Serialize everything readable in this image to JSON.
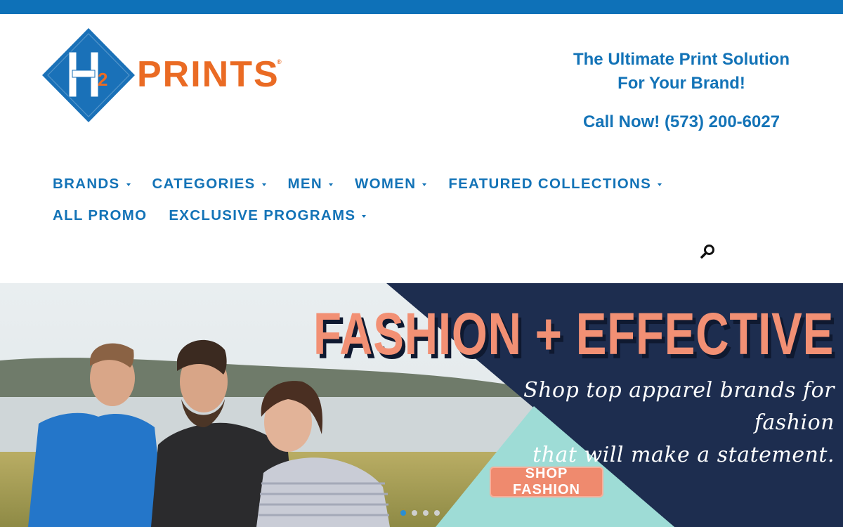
{
  "brand": {
    "logo_mark": "H2",
    "logo_text": "PRINTS",
    "logo_registered": "®",
    "colors": {
      "blue": "#1373b7",
      "orange": "#ea6b24",
      "top_bar": "#0e71b8"
    }
  },
  "header": {
    "tagline_line1": "The Ultimate Print Solution",
    "tagline_line2": "For Your Brand!",
    "phone": "Call Now! (573) 200-6027"
  },
  "nav": {
    "row1": [
      {
        "label": "BRANDS",
        "dropdown": true
      },
      {
        "label": "CATEGORIES",
        "dropdown": true
      },
      {
        "label": "MEN",
        "dropdown": true
      },
      {
        "label": "WOMEN",
        "dropdown": true
      },
      {
        "label": "FEATURED COLLECTIONS",
        "dropdown": true
      }
    ],
    "row2": [
      {
        "label": "ALL PROMO",
        "dropdown": false
      },
      {
        "label": "EXCLUSIVE PROGRAMS",
        "dropdown": true
      }
    ],
    "search_icon": "search-icon"
  },
  "hero": {
    "title": "FASHION + EFFECTIVE",
    "subtitle_line1": "Shop top apparel brands for fashion",
    "subtitle_line2": "that will make a statement.",
    "button": "SHOP FASHION",
    "slides": 4,
    "active_slide": 1,
    "colors": {
      "navy": "#1d2d4f",
      "coral": "#f29074",
      "mint": "#9edcd6"
    }
  }
}
